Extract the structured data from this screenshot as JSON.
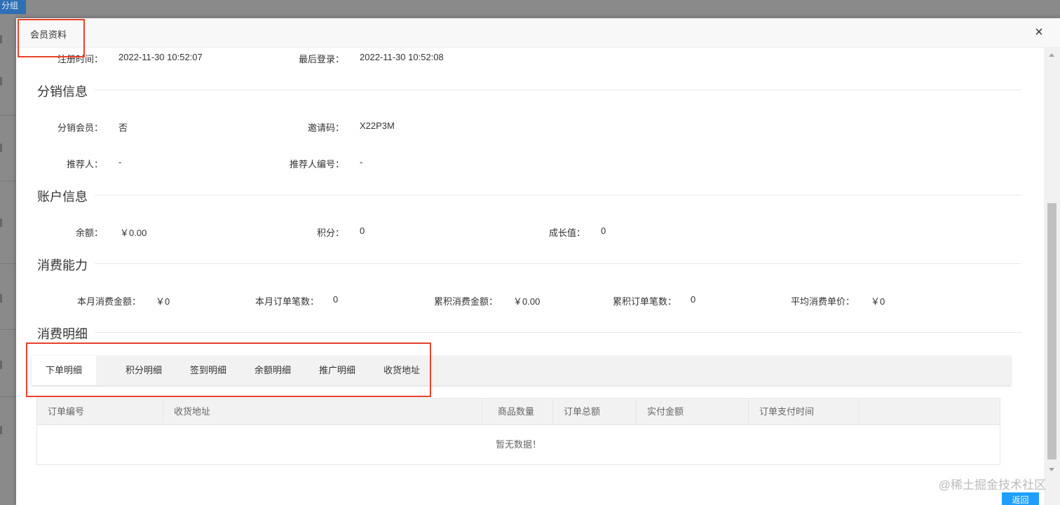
{
  "background": {
    "tag_label": "分组"
  },
  "modal": {
    "title": "会员资料",
    "close_symbol": "×"
  },
  "basic": {
    "register_time_label": "注册时间：",
    "register_time_value": "2022-11-30 10:52:07",
    "last_login_label": "最后登录：",
    "last_login_value": "2022-11-30 10:52:08"
  },
  "distribution": {
    "title": "分销信息",
    "member_label": "分销会员：",
    "member_value": "否",
    "invite_code_label": "邀请码：",
    "invite_code_value": "X22P3M",
    "referrer_label": "推荐人：",
    "referrer_value": "-",
    "referrer_no_label": "推荐人编号：",
    "referrer_no_value": "-"
  },
  "account": {
    "title": "账户信息",
    "balance_label": "余额：",
    "balance_value": "￥0.00",
    "points_label": "积分：",
    "points_value": "0",
    "growth_label": "成长值：",
    "growth_value": "0"
  },
  "consumption": {
    "title": "消费能力",
    "items": [
      {
        "label": "本月消费金额：",
        "value": "￥0"
      },
      {
        "label": "本月订单笔数：",
        "value": "0"
      },
      {
        "label": "累积消费金额：",
        "value": "￥0.00"
      },
      {
        "label": "累积订单笔数：",
        "value": "0"
      },
      {
        "label": "平均消费单价：",
        "value": "￥0"
      }
    ]
  },
  "details": {
    "title": "消费明细",
    "tabs": [
      "下单明细",
      "积分明细",
      "签到明细",
      "余额明细",
      "推广明细",
      "收货地址"
    ],
    "active_tab": "下单明细",
    "columns": [
      "订单编号",
      "收货地址",
      "商品数量",
      "订单总额",
      "实付金额",
      "订单支付时间",
      ""
    ],
    "empty_text": "暂无数据！"
  },
  "footer": {
    "return_label": "返回",
    "watermark": "@稀土掘金技术社区"
  },
  "colors": {
    "highlight": "#e8422a",
    "primary": "#1e9fff"
  }
}
